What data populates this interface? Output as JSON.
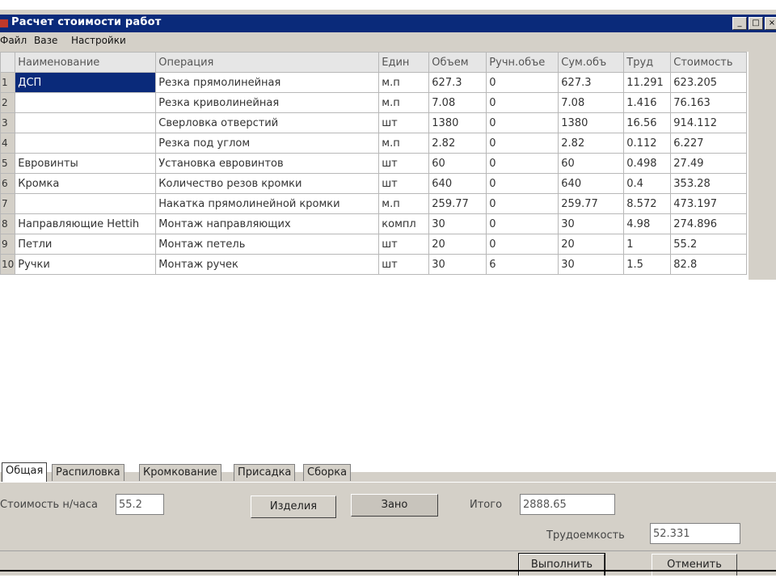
{
  "window": {
    "title": "Расчет стоимости работ"
  },
  "menu": [
    "Файл",
    "Вазе",
    "Настройки"
  ],
  "table": {
    "columns": [
      "Наименование",
      "Операция",
      "Един",
      "Объем",
      "Ручн.объе",
      "Сум.объ",
      "Труд",
      "Стоимость"
    ],
    "rows": [
      {
        "idx": "1",
        "name": "ДСП",
        "op": "Резка прямолинейная",
        "unit": "м.п",
        "vol": "627.3",
        "manual": "0",
        "sum": "627.3",
        "labor": "11.291",
        "cost": "623.205"
      },
      {
        "idx": "2",
        "name": "",
        "op": "Резка криволинейная",
        "unit": "м.п",
        "vol": "7.08",
        "manual": "0",
        "sum": "7.08",
        "labor": "1.416",
        "cost": "76.163"
      },
      {
        "idx": "3",
        "name": "",
        "op": "Сверловка отверстий",
        "unit": "шт",
        "vol": "1380",
        "manual": "0",
        "sum": "1380",
        "labor": "16.56",
        "cost": "914.112"
      },
      {
        "idx": "4",
        "name": "",
        "op": "Резка под углом",
        "unit": "м.п",
        "vol": "2.82",
        "manual": "0",
        "sum": "2.82",
        "labor": "0.112",
        "cost": "6.227"
      },
      {
        "idx": "5",
        "name": "Евровинты",
        "op": "Установка евровинтов",
        "unit": "шт",
        "vol": "60",
        "manual": "0",
        "sum": "60",
        "labor": "0.498",
        "cost": "27.49"
      },
      {
        "idx": "6",
        "name": "Кромка",
        "op": "Количество резов кромки",
        "unit": "шт",
        "vol": "640",
        "manual": "0",
        "sum": "640",
        "labor": "0.4",
        "cost": "353.28"
      },
      {
        "idx": "7",
        "name": "",
        "op": "Накатка прямолинейной кромки",
        "unit": "м.п",
        "vol": "259.77",
        "manual": "0",
        "sum": "259.77",
        "labor": "8.572",
        "cost": "473.197"
      },
      {
        "idx": "8",
        "name": "Направляющие Hettih",
        "op": "Монтаж направляющих",
        "unit": "компл",
        "vol": "30",
        "manual": "0",
        "sum": "30",
        "labor": "4.98",
        "cost": "274.896"
      },
      {
        "idx": "9",
        "name": "Петли",
        "op": "Монтаж петель",
        "unit": "шт",
        "vol": "20",
        "manual": "0",
        "sum": "20",
        "labor": "1",
        "cost": "55.2"
      },
      {
        "idx": "10",
        "name": "Ручки",
        "op": "Монтаж ручек",
        "unit": "шт",
        "vol": "30",
        "manual": "6",
        "sum": "30",
        "labor": "1.5",
        "cost": "82.8"
      }
    ]
  },
  "tabs": [
    "Общая",
    "Распиловка",
    "Кромкование",
    "Присадка",
    "Сборка"
  ],
  "panel": {
    "cost_label": "Стоимость н/часа",
    "cost_value": "55.2",
    "btn_products": "Изделия",
    "btn_zero": "Зано",
    "total_label": "Итого",
    "total_value": "2888.65",
    "labor_label": "Трудоемкость",
    "labor_value": "52.331",
    "btn_execute": "Выполнить",
    "btn_cancel": "Отменить"
  }
}
